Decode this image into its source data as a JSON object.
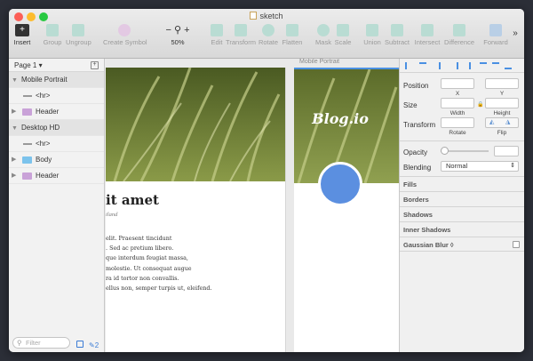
{
  "window": {
    "title": "sketch"
  },
  "toolbar": {
    "insert": "Insert",
    "group": "Group",
    "ungroup": "Ungroup",
    "create_symbol": "Create Symbol",
    "zoom_minus": "−",
    "zoom_plus": "+",
    "zoom_value": "50%",
    "edit": "Edit",
    "transform": "Transform",
    "rotate": "Rotate",
    "flatten": "Flatten",
    "mask": "Mask",
    "scale": "Scale",
    "union": "Union",
    "subtract": "Subtract",
    "intersect": "Intersect",
    "difference": "Difference",
    "forward": "Forward",
    "more": "»"
  },
  "layers": {
    "page": "Page 1 ▾",
    "add": "+",
    "items": [
      {
        "label": "Mobile Portrait"
      },
      {
        "label": "<hr>"
      },
      {
        "label": "Header"
      },
      {
        "label": "Desktop HD"
      },
      {
        "label": "<hr>"
      },
      {
        "label": "Body"
      },
      {
        "label": "Header"
      }
    ],
    "filter_placeholder": "Filter",
    "edit_count": "2"
  },
  "canvas": {
    "artboard_label": "Mobile Portrait",
    "logo_text": "Blog.io",
    "heading": "it amet",
    "meta": "iland",
    "body_lines": [
      "elit. Praesent tincidunt",
      ". Sed ac pretium libero.",
      "que interdum feugiat massa,",
      "molestie. Ut consequat augue",
      "ra id tortor non convallis.",
      "ellus non, semper turpis ut, eleifend."
    ],
    "circle_color": "#5b8fe0"
  },
  "inspector": {
    "position": "Position",
    "x": "X",
    "y": "Y",
    "size": "Size",
    "width": "Width",
    "height": "Height",
    "transform": "Transform",
    "rotate": "Rotate",
    "flip": "Flip",
    "opacity": "Opacity",
    "blending": "Blending",
    "blending_value": "Normal",
    "fills": "Fills",
    "borders": "Borders",
    "shadows": "Shadows",
    "inner_shadows": "Inner Shadows",
    "gaussian_blur": "Gaussian Blur ◊"
  }
}
